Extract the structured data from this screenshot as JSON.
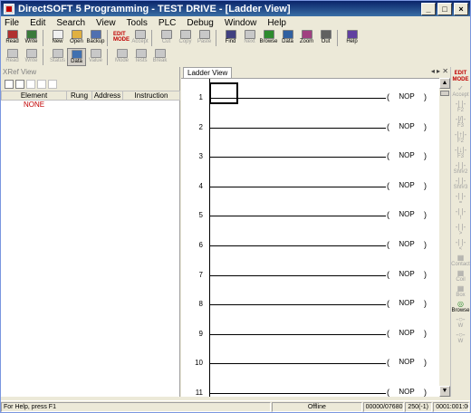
{
  "window": {
    "title": "DirectSOFT 5 Programming - TEST DRIVE - [Ladder View]"
  },
  "menu": [
    "File",
    "Edit",
    "Search",
    "View",
    "Tools",
    "PLC",
    "Debug",
    "Window",
    "Help"
  ],
  "toolbar1": [
    {
      "label": "Read",
      "icon": "read-icon",
      "enabled": true,
      "color": "#b03030"
    },
    {
      "label": "Write",
      "icon": "write-icon",
      "enabled": true,
      "color": "#3a7a3a"
    },
    {
      "label": "New",
      "icon": "new-icon",
      "enabled": true,
      "color": "#f0f0f0"
    },
    {
      "label": "Open",
      "icon": "open-icon",
      "enabled": true,
      "color": "#e0b040"
    },
    {
      "label": "Backup",
      "icon": "backup-icon",
      "enabled": true,
      "color": "#5070b0"
    },
    {
      "label": "EDIT MODE",
      "icon": "edit-mode-icon",
      "enabled": true,
      "color": "#c00000"
    },
    {
      "label": "Accept",
      "icon": "accept-icon",
      "enabled": false,
      "color": "#c0c0c0"
    },
    {
      "label": "Cut",
      "icon": "cut-icon",
      "enabled": false,
      "color": "#c0c0c0"
    },
    {
      "label": "Copy",
      "icon": "copy-icon",
      "enabled": false,
      "color": "#c0c0c0"
    },
    {
      "label": "Paste",
      "icon": "paste-icon",
      "enabled": false,
      "color": "#c0c0c0"
    },
    {
      "label": "Find",
      "icon": "find-icon",
      "enabled": true,
      "color": "#404080"
    },
    {
      "label": "Next",
      "icon": "find-next-icon",
      "enabled": false,
      "color": "#c0c0c0"
    },
    {
      "label": "Browse",
      "icon": "browse-icon",
      "enabled": true,
      "color": "#2e8b2e"
    },
    {
      "label": "Data",
      "icon": "data-view-icon",
      "enabled": true,
      "color": "#3060a0"
    },
    {
      "label": "Zoom",
      "icon": "zoom-icon",
      "enabled": true,
      "color": "#a04080"
    },
    {
      "label": "Out",
      "icon": "zoom-out-icon",
      "enabled": true,
      "color": "#606060"
    },
    {
      "label": "Help",
      "icon": "help-icon",
      "enabled": true,
      "color": "#6040a0"
    }
  ],
  "toolbar2": [
    {
      "label": "Read",
      "icon": "read-status-icon",
      "enabled": false
    },
    {
      "label": "Write",
      "icon": "write-status-icon",
      "enabled": false
    },
    {
      "label": "Status",
      "icon": "status-icon",
      "enabled": false
    },
    {
      "label": "Data",
      "icon": "data-icon",
      "enabled": true
    },
    {
      "label": "Value",
      "icon": "value-icon",
      "enabled": false
    },
    {
      "label": "Mode",
      "icon": "mode-icon",
      "enabled": false
    },
    {
      "label": "Tests",
      "icon": "tests-icon",
      "enabled": false
    },
    {
      "label": "Break",
      "icon": "break-icon",
      "enabled": false
    }
  ],
  "xref": {
    "title": "XRef View",
    "columns": [
      "Element",
      "Rung",
      "Address",
      "Instruction"
    ],
    "rows": [
      {
        "element": "NONE",
        "rung": "",
        "address": "",
        "instruction": ""
      }
    ]
  },
  "ladder": {
    "tab_label": "Ladder View",
    "coil_label": "NOP",
    "coil_open": "(",
    "coil_close": ")",
    "rungs": [
      "1",
      "2",
      "3",
      "4",
      "5",
      "6",
      "7",
      "8",
      "9",
      "10",
      "11"
    ]
  },
  "palette": [
    {
      "label": "EDIT MODE",
      "glyph": "",
      "icon": "edit-mode-icon",
      "active": true
    },
    {
      "label": "Accept",
      "glyph": "✓",
      "icon": "accept-icon"
    },
    {
      "label": "F2",
      "glyph": "-|  |-",
      "icon": "contact-no-icon"
    },
    {
      "label": "F3",
      "glyph": "-|/|-",
      "icon": "contact-nc-icon"
    },
    {
      "label": "F2",
      "glyph": "-|↑|-",
      "icon": "contact-rising-icon"
    },
    {
      "label": "F3",
      "glyph": "-|↓|-",
      "icon": "contact-falling-icon"
    },
    {
      "label": "Shf#2",
      "glyph": "-| |-",
      "icon": "contact-shift2-icon"
    },
    {
      "label": "Shf#3",
      "glyph": "-| |-",
      "icon": "contact-shift3-icon"
    },
    {
      "label": "=",
      "glyph": "-| |-",
      "icon": "compare-equal-icon"
    },
    {
      "label": "!",
      "glyph": "-| |-",
      "icon": "compare-not-icon"
    },
    {
      "label": ">",
      "glyph": "-| |-",
      "icon": "compare-greater-icon"
    },
    {
      "label": "<",
      "glyph": "-| |-",
      "icon": "compare-less-icon"
    },
    {
      "label": "Contact",
      "glyph": "▦",
      "icon": "contact-box-icon"
    },
    {
      "label": "Coil",
      "glyph": "▦",
      "icon": "coil-box-icon"
    },
    {
      "label": "Box",
      "glyph": "▦",
      "icon": "box-instruction-icon"
    },
    {
      "label": "Browse",
      "glyph": "◎",
      "icon": "browse-icon",
      "browse": true
    },
    {
      "label": "W",
      "glyph": "-○-",
      "icon": "wire-icon"
    },
    {
      "label": "W",
      "glyph": "-○-",
      "icon": "wire-2-icon"
    }
  ],
  "status": {
    "help": "For Help, press F1",
    "connection": "Offline",
    "memory": "00000/07680",
    "position": "250(-1)",
    "address": "0001:001:001"
  }
}
